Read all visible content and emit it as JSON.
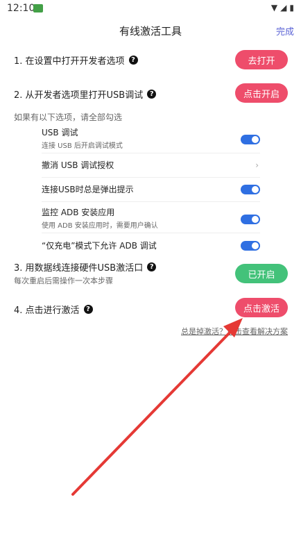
{
  "status": {
    "time": "12:10"
  },
  "header": {
    "title": "有线激活工具",
    "done": "完成"
  },
  "steps": [
    {
      "label": "1. 在设置中打开开发者选项",
      "button": "去打开"
    },
    {
      "label": "2. 从开发者选项里打开USB调试",
      "button": "点击开启"
    },
    {
      "label": "3. 用数据线连接硬件USB激活口",
      "button": "已开启",
      "subtitle": "每次重启后需操作一次本步骤"
    },
    {
      "label": "4. 点击进行激活",
      "button": "点击激活"
    }
  ],
  "hint": "如果有以下选项，请全部勾选",
  "options": [
    {
      "title": "USB 调试",
      "desc": "连接 USB 后开启调试模式"
    },
    {
      "title": "撤消 USB 调试授权",
      "desc": ""
    },
    {
      "title": "连接USB时总是弹出提示",
      "desc": ""
    },
    {
      "title": "监控 ADB 安装应用",
      "desc": "使用 ADB 安装应用时，需要用户确认"
    },
    {
      "title": "“仅充电”模式下允许 ADB 调试",
      "desc": ""
    }
  ],
  "link": "总是掉激活？点击查看解决方案",
  "colors": {
    "pink": "#ee4d6b",
    "green": "#43c27a",
    "blue": "#2f6fe2",
    "arrow": "#e53935"
  }
}
